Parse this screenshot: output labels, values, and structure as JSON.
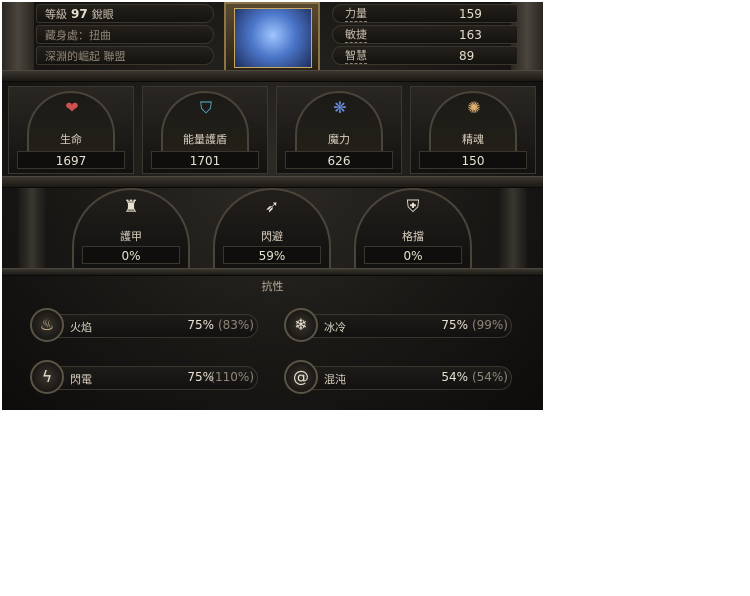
{
  "header": {
    "level_label": "等級",
    "level_value": "97",
    "class_name": "銳眼",
    "hideout": "藏身處：扭曲",
    "guild": "深淵的崛起 聯盟"
  },
  "attributes": [
    {
      "name": "力量",
      "value": "159"
    },
    {
      "name": "敏捷",
      "value": "163"
    },
    {
      "name": "智慧",
      "value": "89"
    }
  ],
  "main_stats": [
    {
      "name": "生命",
      "value": "1697",
      "icon": "heart-icon",
      "color": "#c84a4a"
    },
    {
      "name": "能量護盾",
      "value": "1701",
      "icon": "energy-shield-icon",
      "color": "#4aa8c8"
    },
    {
      "name": "魔力",
      "value": "626",
      "icon": "mana-icon",
      "color": "#4a6ad0"
    },
    {
      "name": "精魂",
      "value": "150",
      "icon": "spirit-icon",
      "color": "#d0a060"
    }
  ],
  "defenses": [
    {
      "name": "護甲",
      "value": "0%",
      "icon": "armour-icon"
    },
    {
      "name": "閃避",
      "value": "59%",
      "icon": "evasion-icon"
    },
    {
      "name": "格擋",
      "value": "0%",
      "icon": "block-icon"
    }
  ],
  "resist_title": "抗性",
  "resistances": [
    {
      "name": "火焰",
      "value": "75%",
      "max": "(83%)",
      "icon": "fire-icon"
    },
    {
      "name": "冰冷",
      "value": "75%",
      "max": "(99%)",
      "icon": "cold-icon"
    },
    {
      "name": "閃電",
      "value": "75%",
      "max": "(110%)",
      "icon": "lightning-icon"
    },
    {
      "name": "混沌",
      "value": "54%",
      "max": "(54%)",
      "icon": "chaos-icon"
    }
  ]
}
